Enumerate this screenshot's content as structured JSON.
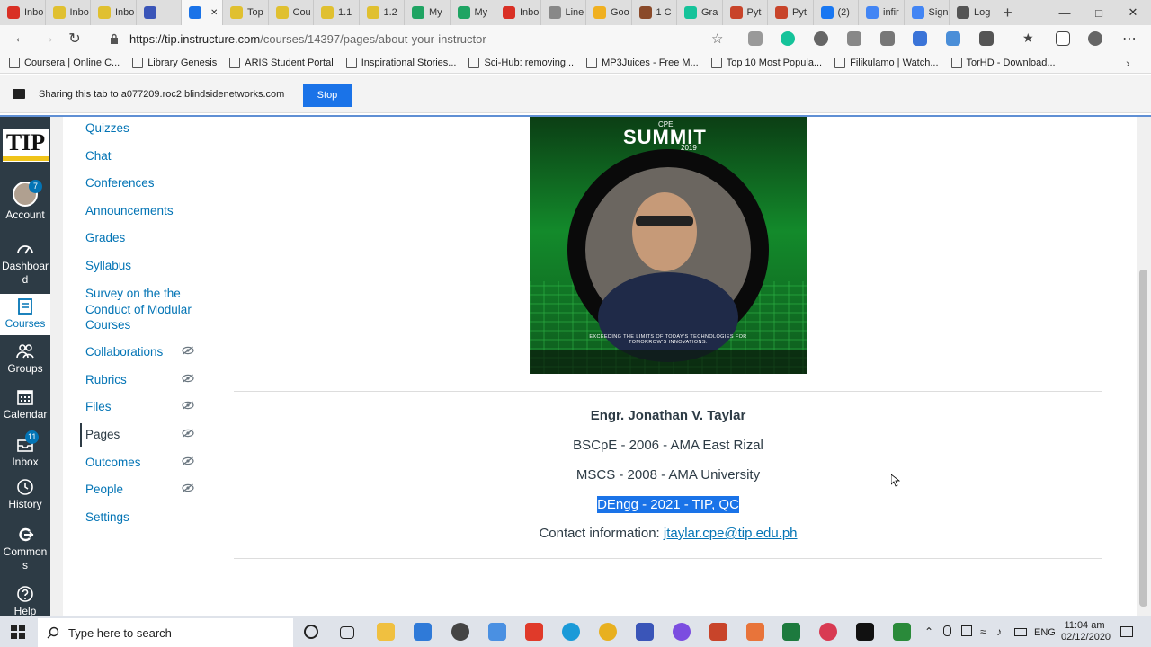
{
  "tabs": [
    "Inbo",
    "Inbo",
    "Inbo",
    "",
    "",
    "Top",
    "Cou",
    "1.1",
    "1.2",
    "My",
    "My",
    "Inbo",
    "Line",
    "Goo",
    "1 C",
    "Gra",
    "Pyt",
    "Pyt",
    "(2)",
    "infir",
    "Sign",
    "Log"
  ],
  "active_tab_index": 4,
  "address": {
    "url_host": "https://tip.instructure.com",
    "url_path": "/courses/14397/pages/about-your-instructor"
  },
  "bookmarks": [
    "Coursera | Online C...",
    "Library Genesis",
    "ARIS Student Portal",
    "Inspirational Stories...",
    "Sci-Hub: removing...",
    "MP3Juices - Free M...",
    "Top 10 Most Popula...",
    "Filikulamo | Watch...",
    "TorHD - Download..."
  ],
  "share": {
    "text": "Sharing this tab to a077209.roc2.blindsidenetworks.com",
    "stop": "Stop"
  },
  "global_nav": {
    "logo": "TIP",
    "account": "Account",
    "account_badge": "7",
    "dashboard": "Dashboar d",
    "courses": "Courses",
    "groups": "Groups",
    "calendar": "Calendar",
    "inbox": "Inbox",
    "inbox_badge": "11",
    "history": "History",
    "commons": "Common s",
    "help": "Help"
  },
  "course_nav": [
    "Quizzes",
    "Chat",
    "Conferences",
    "Announcements",
    "Grades",
    "Syllabus",
    "Survey on the the Conduct of Modular Courses",
    "Collaborations",
    "Rubrics",
    "Files",
    "Pages",
    "Outcomes",
    "People",
    "Settings"
  ],
  "photo": {
    "title": "SUMMIT",
    "brand": "CPE",
    "year": "2019",
    "ring": "EXCEEDING THE LIMITS OF TODAY'S TECHNOLOGIES FOR TOMORROW'S INNOVATIONS."
  },
  "instructor": {
    "name": "Engr. Jonathan V. Taylar",
    "bs": "BSCpE - 2006 - AMA East Rizal",
    "ms": "MSCS - 2008 - AMA University",
    "phd": "DEngg - 2021 - TIP, QC",
    "contact_label": "Contact information: ",
    "email": "jtaylar.cpe@tip.edu.ph"
  },
  "taskbar": {
    "search": "Type here to search",
    "lang": "ENG",
    "time": "11:04 am",
    "date": "02/12/2020"
  }
}
